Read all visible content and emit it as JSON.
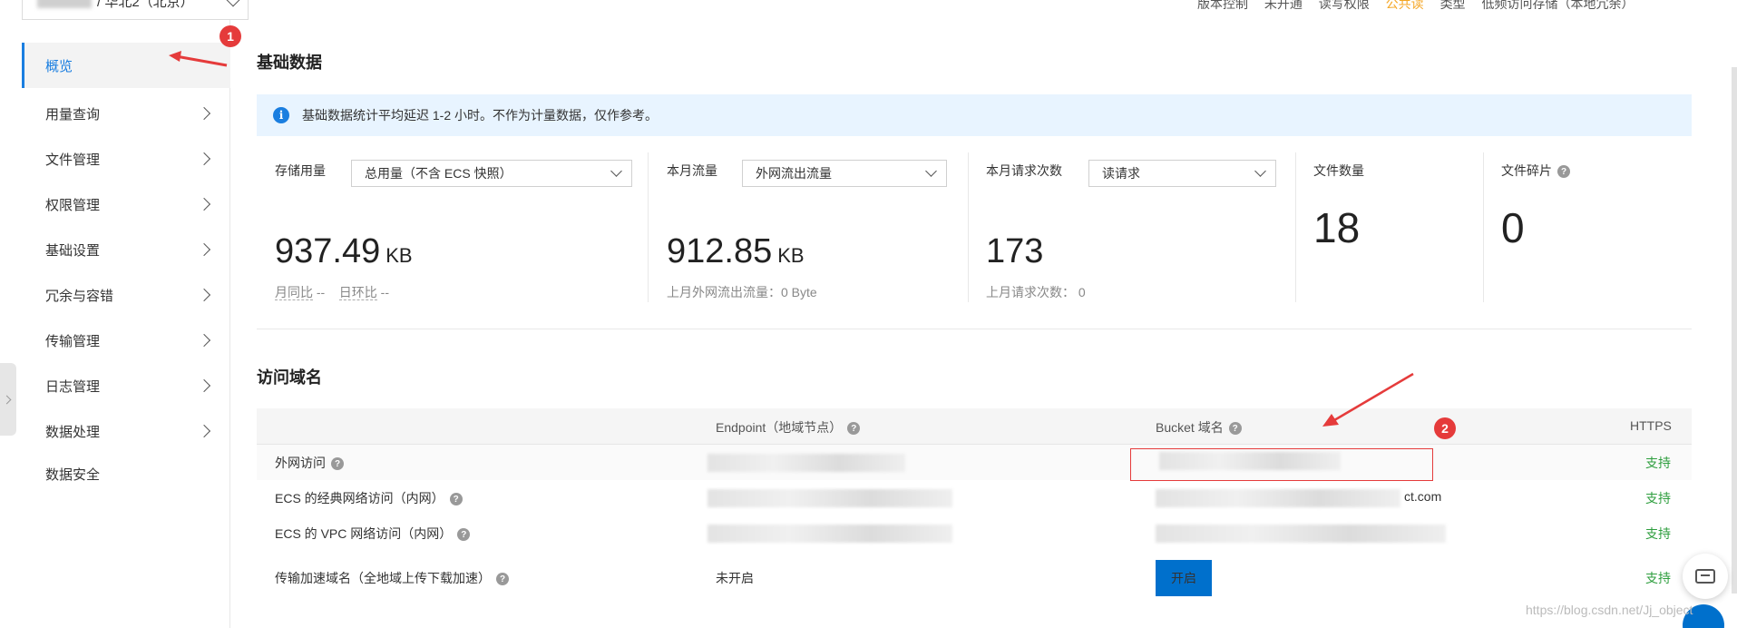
{
  "sidebar": {
    "region_label": "/ 华北2（北京）",
    "items": [
      {
        "label": "概览",
        "active": true
      },
      {
        "label": "用量查询"
      },
      {
        "label": "文件管理"
      },
      {
        "label": "权限管理"
      },
      {
        "label": "基础设置"
      },
      {
        "label": "冗余与容错"
      },
      {
        "label": "传输管理"
      },
      {
        "label": "日志管理"
      },
      {
        "label": "数据处理"
      },
      {
        "label": "数据安全"
      }
    ]
  },
  "topstrip": {
    "version_label": "版本控制",
    "version_value": "未开通",
    "acl_label": "读写权限",
    "acl_value": "公共读",
    "type_label": "类型",
    "type_value": "低频访问存储（本地冗余）"
  },
  "basic": {
    "title": "基础数据",
    "notice": "基础数据统计平均延迟 1-2 小时。不作为计量数据，仅作参考。",
    "storage": {
      "label": "存储用量",
      "select": "总用量（不含 ECS 快照）",
      "value": "937.49",
      "unit": "KB",
      "mom_label": "月同比",
      "mom_value": "--",
      "dod_label": "日环比",
      "dod_value": "--"
    },
    "traffic": {
      "label": "本月流量",
      "select": "外网流出流量",
      "value": "912.85",
      "unit": "KB",
      "sub": "上月外网流出流量：0 Byte"
    },
    "requests": {
      "label": "本月请求次数",
      "select": "读请求",
      "value": "173",
      "sub": "上月请求次数：  0"
    },
    "files": {
      "label": "文件数量",
      "value": "18"
    },
    "fragments": {
      "label": "文件碎片",
      "value": "0"
    }
  },
  "domains": {
    "title": "访问域名",
    "headers": {
      "endpoint": "Endpoint（地域节点）",
      "bucket": "Bucket 域名",
      "https": "HTTPS"
    },
    "rows": [
      {
        "name": "外网访问",
        "has_help": true,
        "https": "支持"
      },
      {
        "name": "ECS 的经典网络访问（内网）",
        "has_help": true,
        "bucket_tail": "ct.com",
        "https": "支持"
      },
      {
        "name": "ECS 的 VPC 网络访问（内网）",
        "has_help": true,
        "https": "支持"
      },
      {
        "name": "传输加速域名（全地域上传下载加速）",
        "has_help": true,
        "endpoint": "未开启",
        "button": "开启",
        "https": "支持"
      }
    ]
  },
  "annotations": {
    "badge1": "1",
    "badge2": "2"
  },
  "watermark": "https://blog.csdn.net/Jj_object"
}
